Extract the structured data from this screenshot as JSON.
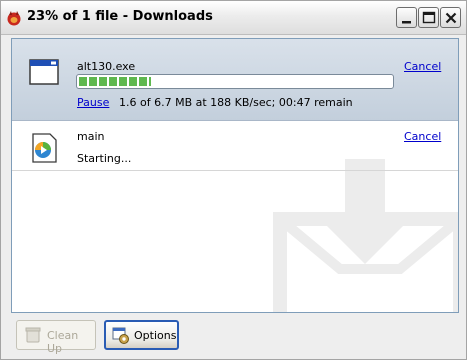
{
  "window": {
    "title": "23% of 1 file - Downloads",
    "app_icon": "firefox-icon",
    "controls": [
      "minimize-icon",
      "maximize-icon",
      "close-icon"
    ]
  },
  "downloads": [
    {
      "name": "alt130.exe",
      "icon": "application-window-icon",
      "progress_percent": 23,
      "pause_label": "Pause",
      "status": "1.6 of 6.7 MB at 188 KB/sec; 00:47 remain",
      "cancel_label": "Cancel",
      "selected": true
    },
    {
      "name": "main",
      "icon": "media-player-icon",
      "status": "Starting...",
      "cancel_label": "Cancel",
      "selected": false
    }
  ],
  "footer": {
    "cleanup_label": "Clean Up",
    "cleanup_icon": "broom-icon",
    "cleanup_enabled": false,
    "options_label": "Options",
    "options_icon": "gear-icon"
  },
  "colors": {
    "link": "#0000cc",
    "progress": "#5fb84f",
    "selected_row": "#c3cfdc"
  }
}
